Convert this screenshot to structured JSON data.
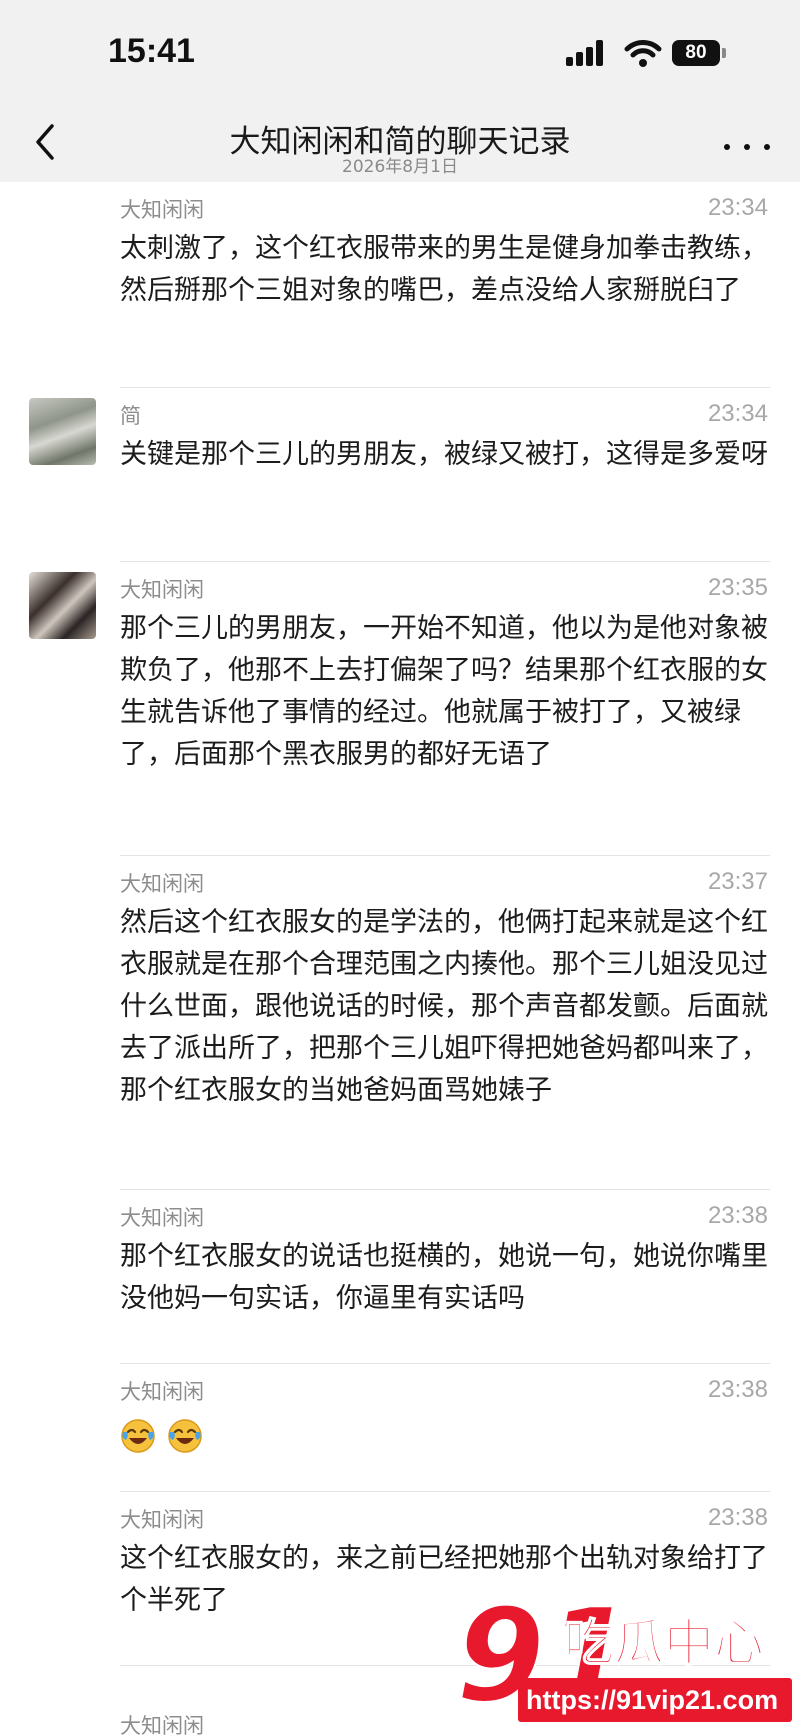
{
  "status_bar": {
    "time": "15:41",
    "battery": "80"
  },
  "nav": {
    "title": "大知闲闲和简的聊天记录",
    "date": "2026年8月1日"
  },
  "messages": [
    {
      "sender": "大知闲闲",
      "time": "23:34",
      "text": "太刺激了，这个红衣服带来的男生是健身加拳击教练，然后掰那个三姐对象的嘴巴，差点没给人家掰脱臼了"
    },
    {
      "sender": "简",
      "time": "23:34",
      "text": "关键是那个三儿的男朋友，被绿又被打，这得是多爱呀"
    },
    {
      "sender": "大知闲闲",
      "time": "23:35",
      "text": "那个三儿的男朋友，一开始不知道，他以为是他对象被欺负了，他那不上去打偏架了吗？结果那个红衣服的女生就告诉他了事情的经过。他就属于被打了，又被绿了，后面那个黑衣服男的都好无语了"
    },
    {
      "sender": "大知闲闲",
      "time": "23:37",
      "text": "然后这个红衣服女的是学法的，他俩打起来就是这个红衣服就是在那个合理范围之内揍他。那个三儿姐没见过什么世面，跟他说话的时候，那个声音都发颤。后面就去了派出所了，把那个三儿姐吓得把她爸妈都叫来了，那个红衣服女的当她爸妈面骂她婊子"
    },
    {
      "sender": "大知闲闲",
      "time": "23:38",
      "text": "那个红衣服女的说话也挺横的，她说一句，她说你嘴里没他妈一句实话，你逼里有实话吗"
    },
    {
      "sender": "大知闲闲",
      "time": "23:38",
      "emojis": [
        "laughing-crying-icon",
        "laughing-crying-icon"
      ]
    },
    {
      "sender": "大知闲闲",
      "time": "23:38",
      "text": "这个红衣服女的，来之前已经把她那个出轨对象给打了个半死了"
    }
  ],
  "watermark": {
    "brand_number": "91",
    "brand_name": "吃瓜中心",
    "url": "https://91vip21.com"
  },
  "colors": {
    "bar_bg": "#f1f1f1",
    "watermark_red": "#e8182d"
  }
}
